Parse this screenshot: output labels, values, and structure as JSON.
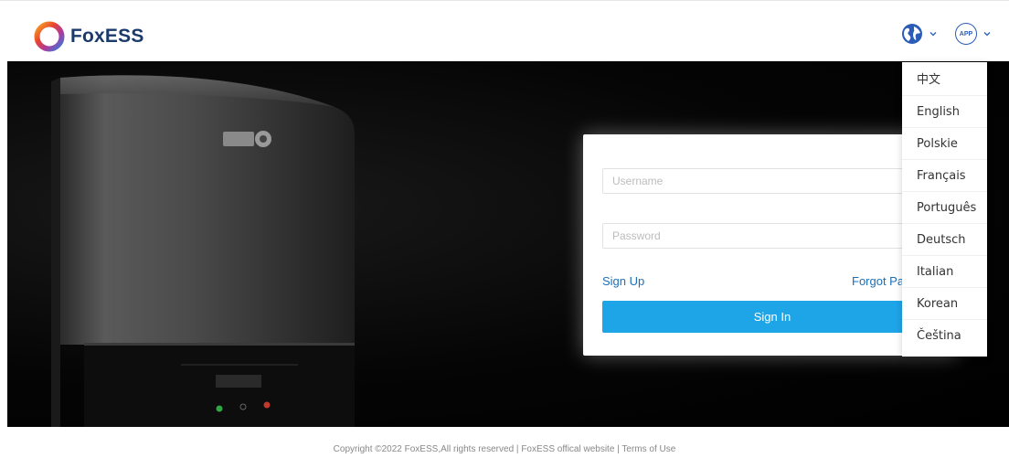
{
  "header": {
    "brand_name": "FoxESS",
    "app_badge": "APP"
  },
  "login": {
    "username_placeholder": "Username",
    "password_placeholder": "Password",
    "signup_label": "Sign Up",
    "forgot_label": "Forgot Pa",
    "signin_label": "Sign In"
  },
  "language_menu": {
    "items": [
      "中文",
      "English",
      "Polskie",
      "Français",
      "Português",
      "Deutsch",
      "Italian",
      "Korean",
      "Čeština"
    ]
  },
  "footer": {
    "copyright": "Copyright ©2022 FoxESS,All rights reserved",
    "separator": "|",
    "official_site": "FoxESS offical website",
    "terms": "Terms of Use"
  },
  "colors": {
    "primary_button": "#1ea5e8",
    "link": "#1c6fb8",
    "brand_text": "#1a3a6b",
    "globe": "#2a5cb8"
  },
  "icons": {
    "logo": "foxess-logo-icon",
    "globe": "globe-icon",
    "chevron": "chevron-down-icon",
    "app": "app-icon"
  }
}
